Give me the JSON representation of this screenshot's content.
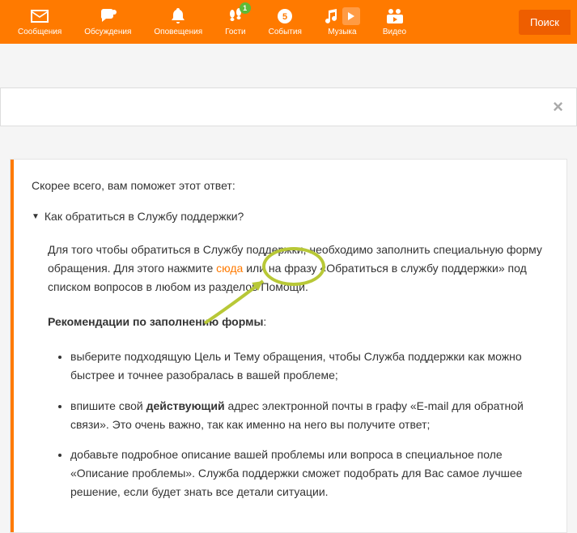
{
  "nav": {
    "items": [
      {
        "label": "Сообщения"
      },
      {
        "label": "Обсуждения"
      },
      {
        "label": "Оповещения"
      },
      {
        "label": "Гости",
        "badge": "1"
      },
      {
        "label": "События"
      },
      {
        "label": "Музыка"
      },
      {
        "label": "Видео"
      }
    ],
    "search": "Поиск"
  },
  "close_icon": "×",
  "suggest": "Скорее всего, вам поможет этот ответ:",
  "question": "Как обратиться в Службу поддержки?",
  "answer": {
    "p1a": "Для того чтобы обратиться в Службу поддержки, необходимо заполнить специальную форму обращения. Для этого нажмите ",
    "link": "сюда",
    "p1b": " или на фразу «Обратиться в службу поддержки» под списком вопросов в любом из разделов Помощи.",
    "rec_title": "Рекомендации по заполнению формы",
    "colon": ":",
    "li1": "выберите подходящую Цель и Тему обращения, чтобы Служба поддержки как можно быстрее и точнее разобралась в вашей проблеме;",
    "li2a": "впишите свой ",
    "li2b": "действующий",
    "li2c": " адрес электронной почты в графу «E-mail для обратной связи». Это очень важно, так как именно на него вы получите ответ;",
    "li3": "добавьте подробное описание вашей проблемы или вопроса в специальное поле «Описание проблемы». Служба поддержки сможет подобрать для Вас самое лучшее решение, если будет знать все детали ситуации."
  }
}
